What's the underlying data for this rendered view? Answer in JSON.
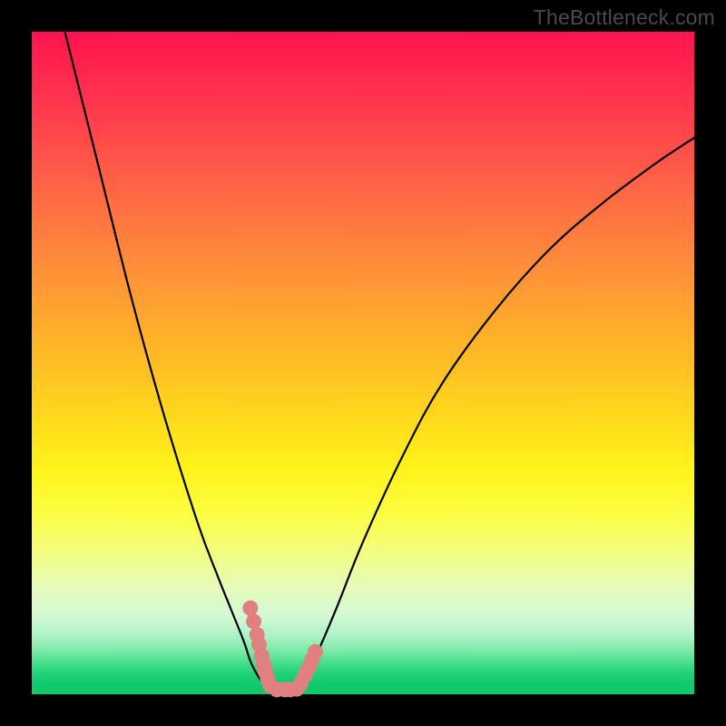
{
  "watermark": "TheBottleneck.com",
  "chart_data": {
    "type": "line",
    "title": "",
    "xlabel": "",
    "ylabel": "",
    "xlim": [
      0,
      100
    ],
    "ylim": [
      0,
      100
    ],
    "series": [
      {
        "name": "curve-left",
        "x": [
          5,
          10,
          15,
          20,
          25,
          28,
          30,
          32,
          33,
          34,
          35,
          36
        ],
        "y": [
          100,
          80,
          60,
          42,
          26,
          18,
          13,
          8,
          5,
          3,
          1.5,
          0.5
        ]
      },
      {
        "name": "curve-right",
        "x": [
          40,
          41,
          43,
          46,
          50,
          56,
          62,
          70,
          78,
          86,
          94,
          100
        ],
        "y": [
          0.5,
          2,
          6,
          13,
          23,
          36,
          47,
          58,
          67,
          74,
          80,
          84
        ]
      }
    ],
    "highlights": {
      "name": "pink-segments",
      "color": "#e08080",
      "points": [
        {
          "x": 33.0,
          "y": 13.0
        },
        {
          "x": 33.5,
          "y": 11.0
        },
        {
          "x": 34.0,
          "y": 9.0
        },
        {
          "x": 34.3,
          "y": 7.5
        },
        {
          "x": 34.7,
          "y": 5.8
        },
        {
          "x": 35.0,
          "y": 4.5
        },
        {
          "x": 35.3,
          "y": 3.3
        },
        {
          "x": 35.6,
          "y": 2.3
        },
        {
          "x": 36.0,
          "y": 1.3
        },
        {
          "x": 37.0,
          "y": 0.7
        },
        {
          "x": 38.2,
          "y": 0.7
        },
        {
          "x": 39.0,
          "y": 0.7
        },
        {
          "x": 40.0,
          "y": 0.8
        },
        {
          "x": 40.6,
          "y": 1.6
        },
        {
          "x": 41.2,
          "y": 2.8
        },
        {
          "x": 41.8,
          "y": 4.0
        },
        {
          "x": 42.3,
          "y": 5.2
        },
        {
          "x": 42.8,
          "y": 6.4
        }
      ]
    },
    "gradient_stops": [
      {
        "pos": 0.0,
        "color": "#ff134f"
      },
      {
        "pos": 0.5,
        "color": "#ffd81c"
      },
      {
        "pos": 0.72,
        "color": "#fcfe44"
      },
      {
        "pos": 0.92,
        "color": "#7be9a7"
      },
      {
        "pos": 1.0,
        "color": "#10c96d"
      }
    ]
  }
}
